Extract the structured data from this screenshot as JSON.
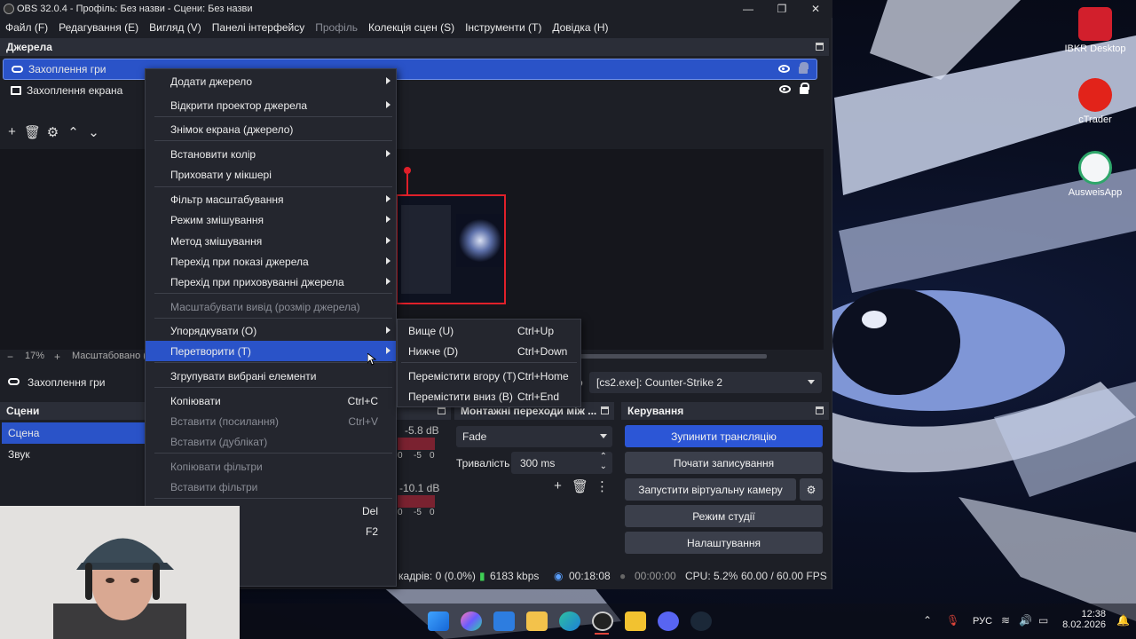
{
  "window": {
    "title": "OBS 32.0.4 - Профіль: Без назви - Сцени: Без назви"
  },
  "menubar": [
    {
      "label": "Файл (F)",
      "enabled": true
    },
    {
      "label": "Редагування (E)",
      "enabled": true
    },
    {
      "label": "Вигляд (V)",
      "enabled": true
    },
    {
      "label": "Панелі інтерфейсу",
      "enabled": true
    },
    {
      "label": "Профіль",
      "enabled": false
    },
    {
      "label": "Колекція сцен (S)",
      "enabled": true
    },
    {
      "label": "Інструменти (T)",
      "enabled": true
    },
    {
      "label": "Довідка (H)",
      "enabled": true
    }
  ],
  "sources": {
    "title": "Джерела",
    "items": [
      {
        "label": "Захоплення гри",
        "selected": true
      },
      {
        "label": "Захоплення екрана",
        "selected": false
      }
    ]
  },
  "preview": {
    "zoom": "17%",
    "scale_status": "Масштабовано (33"
  },
  "source_bar": {
    "name": "Захоплення гри",
    "window_value": "[cs2.exe]: Counter-Strike 2"
  },
  "context_menu": {
    "items": [
      {
        "label": "Додати джерело",
        "submenu": true
      },
      {
        "label": "Відкрити проектор джерела",
        "submenu": true
      },
      {
        "label": "Знімок екрана (джерело)"
      },
      {
        "label": "Встановити колір",
        "submenu": true
      },
      {
        "label": "Приховати у мікшері"
      },
      {
        "label": "Фільтр масштабування",
        "submenu": true
      },
      {
        "label": "Режим змішування",
        "submenu": true
      },
      {
        "label": "Метод змішування",
        "submenu": true
      },
      {
        "label": "Перехід при показі джерела",
        "submenu": true
      },
      {
        "label": "Перехід при приховуванні джерела",
        "submenu": true
      },
      {
        "label": "Масштабувати вивід (розмір джерела)",
        "disabled": true
      },
      {
        "label": "Упорядкувати (O)",
        "submenu": true
      },
      {
        "label": "Перетворити (T)",
        "submenu": true,
        "highlighted": true
      },
      {
        "label": "Згрупувати вибрані елементи"
      },
      {
        "label": "Копіювати",
        "shortcut": "Ctrl+C"
      },
      {
        "label": "Вставити (посилання)",
        "shortcut": "Ctrl+V",
        "disabled": true
      },
      {
        "label": "Вставити (дублікат)",
        "disabled": true
      },
      {
        "label": "Копіювати фільтри",
        "disabled": true
      },
      {
        "label": "Вставити фільтри",
        "disabled": true
      },
      {
        "label": "",
        "shortcut": "Del"
      },
      {
        "label": "и",
        "shortcut": "F2"
      }
    ]
  },
  "submenu": {
    "items": [
      {
        "label": "Вище (U)",
        "shortcut": "Ctrl+Up"
      },
      {
        "label": "Нижче (D)",
        "shortcut": "Ctrl+Down"
      },
      {
        "label": "Перемістити вгору (T)",
        "shortcut": "Ctrl+Home"
      },
      {
        "label": "Перемістити вниз (B)",
        "shortcut": "Ctrl+End"
      }
    ]
  },
  "scenes": {
    "title": "Сцени",
    "items": [
      {
        "label": "Сцена",
        "selected": true
      },
      {
        "label": "Звук",
        "selected": false
      }
    ]
  },
  "mixer": {
    "levels": [
      "-5.8 dB",
      "-10.1 dB"
    ],
    "ticks": [
      "0",
      "-5",
      "0"
    ]
  },
  "transitions": {
    "title": "Монтажні переходи між ...",
    "selected": "Fade",
    "duration_label": "Тривалість",
    "duration": "300 ms"
  },
  "controls": {
    "title": "Керування",
    "buttons": [
      "Зупинити трансляцію",
      "Почати записування",
      "Запустити віртуальну камеру",
      "Режим студії",
      "Налаштування"
    ]
  },
  "status": {
    "frames": "кадрів: 0 (0.0%)",
    "bitrate": "6183 kbps",
    "stream_time": "00:18:08",
    "rec_time": "00:00:00",
    "cpu": "CPU: 5.2%",
    "fps": "60.00 / 60.00 FPS"
  },
  "desktop_icons": [
    {
      "label": "IBKR Desktop"
    },
    {
      "label": "cTrader"
    },
    {
      "label": "AusweisApp"
    }
  ],
  "taskbar": {
    "lang": "РУС",
    "time": "12:38",
    "date": "8.02.2026"
  },
  "colors": {
    "accent": "#2a53c8",
    "window_bg": "#1d1f26",
    "primary_button": "#2c56d6"
  }
}
